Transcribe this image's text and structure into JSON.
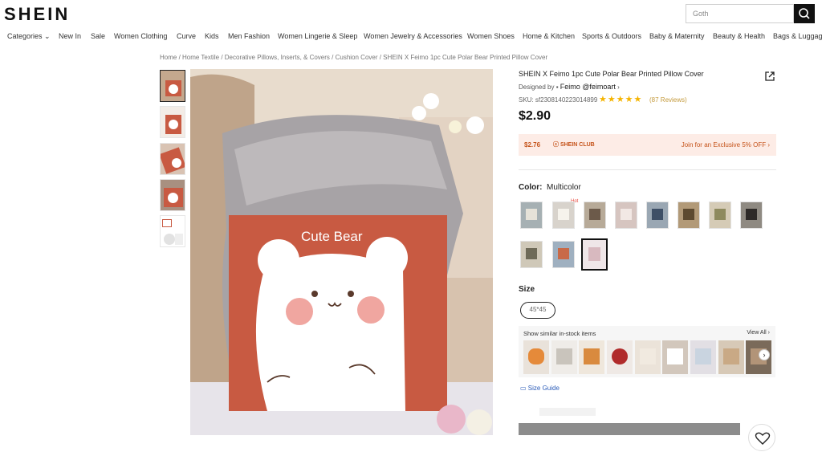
{
  "header": {
    "logo": "SHEIN",
    "search_value": "Goth"
  },
  "nav": [
    "Categories ⌄",
    "New In",
    "Sale",
    "Women Clothing",
    "Curve",
    "Kids",
    "Men Fashion",
    "Women Lingerie & Sleep",
    "Women Jewelry & Accessories",
    "Women Shoes",
    "Home & Kitchen",
    "Sports & Outdoors",
    "Baby & Maternity",
    "Beauty & Health",
    "Bags & Luggage"
  ],
  "breadcrumb": "Home / Home Textile / Decorative Pillows, Inserts, & Covers / Cushion Cover / SHEIN X Feimo 1pc Cute Polar Bear Printed Pillow Cover",
  "product": {
    "title": "SHEIN X Feimo 1pc Cute Polar Bear Printed Pillow Cover",
    "designed_by": "Designed by",
    "designer": "Feimo @feimoart",
    "sku": "SKU: sf2308140223014899",
    "stars": "★★★★★",
    "reviews": "(87 Reviews)",
    "price": "$2.90",
    "pillow_text": "Cute Bear"
  },
  "club": {
    "price": "$2.76",
    "badge": "SHEIN CLUB",
    "join": "Join for an Exclusive 5% OFF ›"
  },
  "color": {
    "label": "Color:",
    "value": "Multicolor",
    "hot": "Hot"
  },
  "size": {
    "label": "Size",
    "option": "45*45"
  },
  "similar": {
    "title": "Show similar in-stock items",
    "view_all": "View All ›"
  },
  "size_guide": "Size Guide",
  "colors": {
    "accent": "#c85a42",
    "club_bg": "#fdece6",
    "club_text": "#c5531a",
    "stars": "#f5b400",
    "link": "#2a5bb8"
  }
}
